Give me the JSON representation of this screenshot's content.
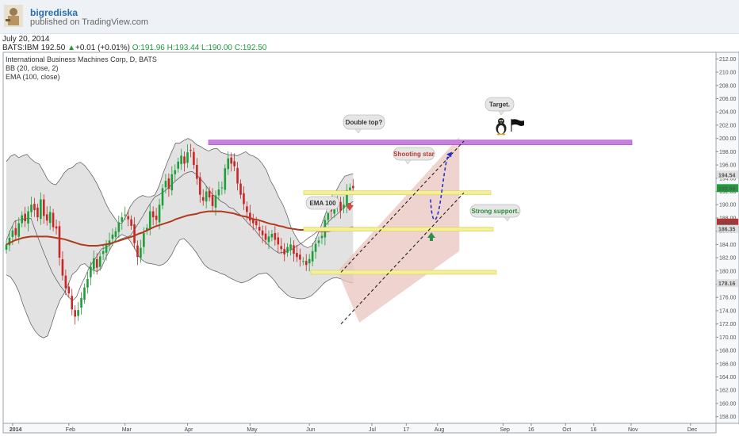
{
  "header": {
    "author": "bigrediska",
    "published": "published on TradingView.com"
  },
  "date": "July 20, 2014",
  "quote": {
    "symbol": "BATS:IBM",
    "last": "192.50",
    "change": "+0.01 (+0.01%)",
    "open": "O:191.96",
    "high": "H:193.44",
    "low": "L:190.00",
    "close": "C:192.50"
  },
  "legend": {
    "title": "International Business Machines Corp, D, BATS",
    "bb": "BB (20, close, 2)",
    "ema": "EMA (100, close)"
  },
  "chart_data": {
    "type": "candlestick",
    "title": "International Business Machines Corp, D, BATS",
    "ylim": [
      157,
      213
    ],
    "y_ticks": [
      "158.00",
      "160.00",
      "162.00",
      "164.00",
      "166.00",
      "168.00",
      "170.00",
      "172.00",
      "174.00",
      "176.00",
      "178.00",
      "180.00",
      "182.00",
      "184.00",
      "186.00",
      "188.00",
      "190.00",
      "192.00",
      "194.00",
      "196.00",
      "198.00",
      "200.00",
      "202.00",
      "204.00",
      "206.00",
      "208.00",
      "210.00",
      "212.00"
    ],
    "x_ticks": [
      {
        "label": "2014",
        "i": 2
      },
      {
        "label": "Feb",
        "i": 20
      },
      {
        "label": "Mar",
        "i": 38
      },
      {
        "label": "Apr",
        "i": 58
      },
      {
        "label": "May",
        "i": 78
      },
      {
        "label": "Jun",
        "i": 97
      },
      {
        "label": "Jul",
        "i": 117
      },
      {
        "label": "17",
        "i": 128
      },
      {
        "label": "Aug",
        "i": 138
      },
      {
        "label": "Sep",
        "i": 159
      },
      {
        "label": "16",
        "i": 168
      },
      {
        "label": "Oct",
        "i": 179
      },
      {
        "label": "16",
        "i": 188
      },
      {
        "label": "Nov",
        "i": 200
      },
      {
        "label": "Dec",
        "i": 219
      }
    ],
    "price_labels": [
      {
        "value": "194.54",
        "y": 194.54,
        "color": "#e0e0e0",
        "text_color": "#333333"
      },
      {
        "value": "192.50",
        "y": 192.5,
        "color": "#1e9e3a",
        "text_color": "#ffffff"
      },
      {
        "value": "186.85",
        "y": 187.3,
        "color": "#b83030",
        "text_color": "#ffffff"
      },
      {
        "value": "186.35",
        "y": 186.35,
        "color": "#e0e0e0",
        "text_color": "#333333"
      },
      {
        "value": "178.16",
        "y": 178.16,
        "color": "#e0e0e0",
        "text_color": "#333333"
      }
    ],
    "closes": [
      184.0,
      185.0,
      186.1,
      185.4,
      187.2,
      188.4,
      187.5,
      189.0,
      190.0,
      189.2,
      188.1,
      190.8,
      188.3,
      187.6,
      188.9,
      186.6,
      186.4,
      182.0,
      179.3,
      177.4,
      176.6,
      174.2,
      173.1,
      174.1,
      175.9,
      177.5,
      178.8,
      180.6,
      181.9,
      180.5,
      182.2,
      183.0,
      183.9,
      184.6,
      185.5,
      186.0,
      187.3,
      188.1,
      188.5,
      187.8,
      186.8,
      184.2,
      182.1,
      183.5,
      185.7,
      186.5,
      189.0,
      188.1,
      187.7,
      190.0,
      192.5,
      193.6,
      192.4,
      194.6,
      195.2,
      196.5,
      197.4,
      196.2,
      197.9,
      198.2,
      196.0,
      193.9,
      191.5,
      190.6,
      192.0,
      191.1,
      189.8,
      191.4,
      192.3,
      192.6,
      195.5,
      197.0,
      196.2,
      195.8,
      193.2,
      191.5,
      190.1,
      188.9,
      187.6,
      187.2,
      186.9,
      186.1,
      185.4,
      184.7,
      185.2,
      185.6,
      184.7,
      184.0,
      183.3,
      182.5,
      183.6,
      184.0,
      182.6,
      182.1,
      181.7,
      181.5,
      180.9,
      181.8,
      183.0,
      184.1,
      184.6,
      185.3,
      187.7,
      189.3,
      189.0,
      189.9,
      190.3,
      189.1,
      190.0,
      192.2,
      192.6,
      192.5
    ],
    "bb_upper": [
      196.5,
      197.3,
      197.6,
      197.1,
      197.4,
      197.6,
      196.9,
      196.4,
      196.1,
      195.0,
      193.8,
      193.2,
      193.0,
      193.8,
      194.8,
      195.4,
      195.6,
      196.2,
      196.4,
      195.9,
      195.1,
      194.2,
      193.1,
      191.8,
      190.3,
      189.1,
      188.2,
      187.3,
      187.2,
      188.3,
      189.7,
      190.6,
      191.1,
      191.4,
      191.2,
      191.2,
      191.5,
      192.8,
      194.8,
      196.4,
      197.9,
      199.3,
      199.3,
      199.7,
      200.0,
      199.7,
      199.1,
      198.8,
      198.4,
      198.1,
      198.4,
      198.5,
      197.9,
      197.7,
      197.5,
      197.5,
      197.4,
      197.7,
      198.0,
      197.5,
      197.3,
      196.9,
      196.2,
      195.2,
      193.6,
      192.5,
      191.1,
      190.0,
      188.4,
      186.5,
      185.3,
      184.3,
      183.8,
      183.5,
      183.8,
      184.8,
      186.4,
      188.1,
      189.8,
      191.5,
      192.2,
      193.4,
      194.3,
      194.5,
      194.7
    ],
    "bb_middle": [
      184.6,
      186.2,
      187.5,
      187.7,
      187.8,
      187.9,
      187.9,
      186.1,
      184.5,
      182.9,
      181.4,
      179.9,
      178.8,
      177.8,
      177.0,
      176.1,
      175.5,
      176.1,
      177.7,
      179.0,
      180.4,
      181.4,
      182.3,
      183.3,
      183.5,
      183.9,
      184.3,
      184.6,
      184.9,
      185.1,
      185.3,
      186.2,
      187.2,
      188.2,
      189.3,
      190.3,
      191.2,
      191.5,
      191.9,
      192.4,
      193.0,
      193.6,
      194.1,
      194.6,
      194.9,
      195.0,
      194.6,
      193.9,
      193.2,
      192.3,
      191.5,
      191.1,
      190.5,
      190.2,
      189.6,
      189.4,
      188.8,
      188.3,
      187.6,
      186.9,
      186.4,
      185.5,
      184.8,
      184.2,
      183.6,
      183.1,
      182.7,
      182.8,
      183.0,
      183.2,
      183.6,
      184.0,
      184.4,
      184.9,
      185.3,
      185.8,
      186.2,
      186.7,
      187.4,
      188.0,
      188.5,
      189.1,
      189.7,
      190.1,
      190.5
    ],
    "bb_lower": [
      179.4,
      179.1,
      178.2,
      176.9,
      175.0,
      173.4,
      171.9,
      170.9,
      170.2,
      169.9,
      170.2,
      172.0,
      174.0,
      175.6,
      176.6,
      178.0,
      179.5,
      180.0,
      180.9,
      181.1,
      180.5,
      180.1,
      179.9,
      180.4,
      181.9,
      183.1,
      184.3,
      185.1,
      185.5,
      185.2,
      184.5,
      183.5,
      182.3,
      181.6,
      181.2,
      181.1,
      181.0,
      180.8,
      181.0,
      181.5,
      182.4,
      183.7,
      184.7,
      184.9,
      184.3,
      183.6,
      182.8,
      181.8,
      180.9,
      180.4,
      180.1,
      179.9,
      179.6,
      179.4,
      179.0,
      178.7,
      178.4,
      178.2,
      178.4,
      178.7,
      179.1,
      179.5,
      179.6,
      179.7,
      179.2,
      178.5,
      177.6,
      177.0,
      176.4,
      176.0,
      175.9,
      175.8,
      175.8,
      176.0,
      176.3,
      176.9,
      177.5,
      178.2,
      178.6,
      178.9,
      179.0,
      178.8,
      178.5,
      178.3,
      178.2
    ],
    "ema100": [
      184.0,
      184.3,
      184.6,
      184.8,
      185.0,
      185.1,
      185.2,
      185.2,
      185.2,
      185.2,
      185.2,
      185.1,
      185.0,
      184.9,
      184.8,
      184.6,
      184.4,
      184.2,
      184.0,
      183.9,
      183.8,
      183.8,
      183.8,
      183.9,
      184.0,
      184.1,
      184.3,
      184.5,
      184.7,
      184.9,
      185.1,
      185.3,
      185.6,
      185.8,
      186.1,
      186.4,
      186.7,
      186.9,
      187.1,
      187.3,
      187.5,
      187.8,
      188.0,
      188.2,
      188.4,
      188.5,
      188.6,
      188.8,
      188.9,
      189.0,
      189.0,
      189.0,
      189.0,
      188.9,
      188.8,
      188.7,
      188.5,
      188.3,
      188.2,
      188.0,
      187.8,
      187.7,
      187.5,
      187.3,
      187.1,
      187.0,
      186.8,
      186.7,
      186.5,
      186.4,
      186.3,
      186.2,
      186.2,
      186.1,
      186.1,
      186.1,
      186.0,
      186.0,
      186.0,
      186.1,
      186.2,
      186.3,
      186.4,
      186.5,
      186.6
    ]
  },
  "annotations": {
    "double_top": "Double top?",
    "shooting_star": "Shooting star",
    "ema100": "EMA 100",
    "strong_support": "Strong support.",
    "target": "Target.",
    "colors": {
      "resistance_band": "#c97fe0",
      "support_band": "#f4ef9a",
      "channel_fill": "#e9c4bd",
      "bb_fill": "#d8d8d8",
      "ema_line": "#b13a1e",
      "up_candle": "#1e9e3a",
      "down_candle": "#c62828",
      "projection": "#2233cc"
    },
    "icons": [
      "penguin-icon",
      "flag-icon"
    ]
  }
}
